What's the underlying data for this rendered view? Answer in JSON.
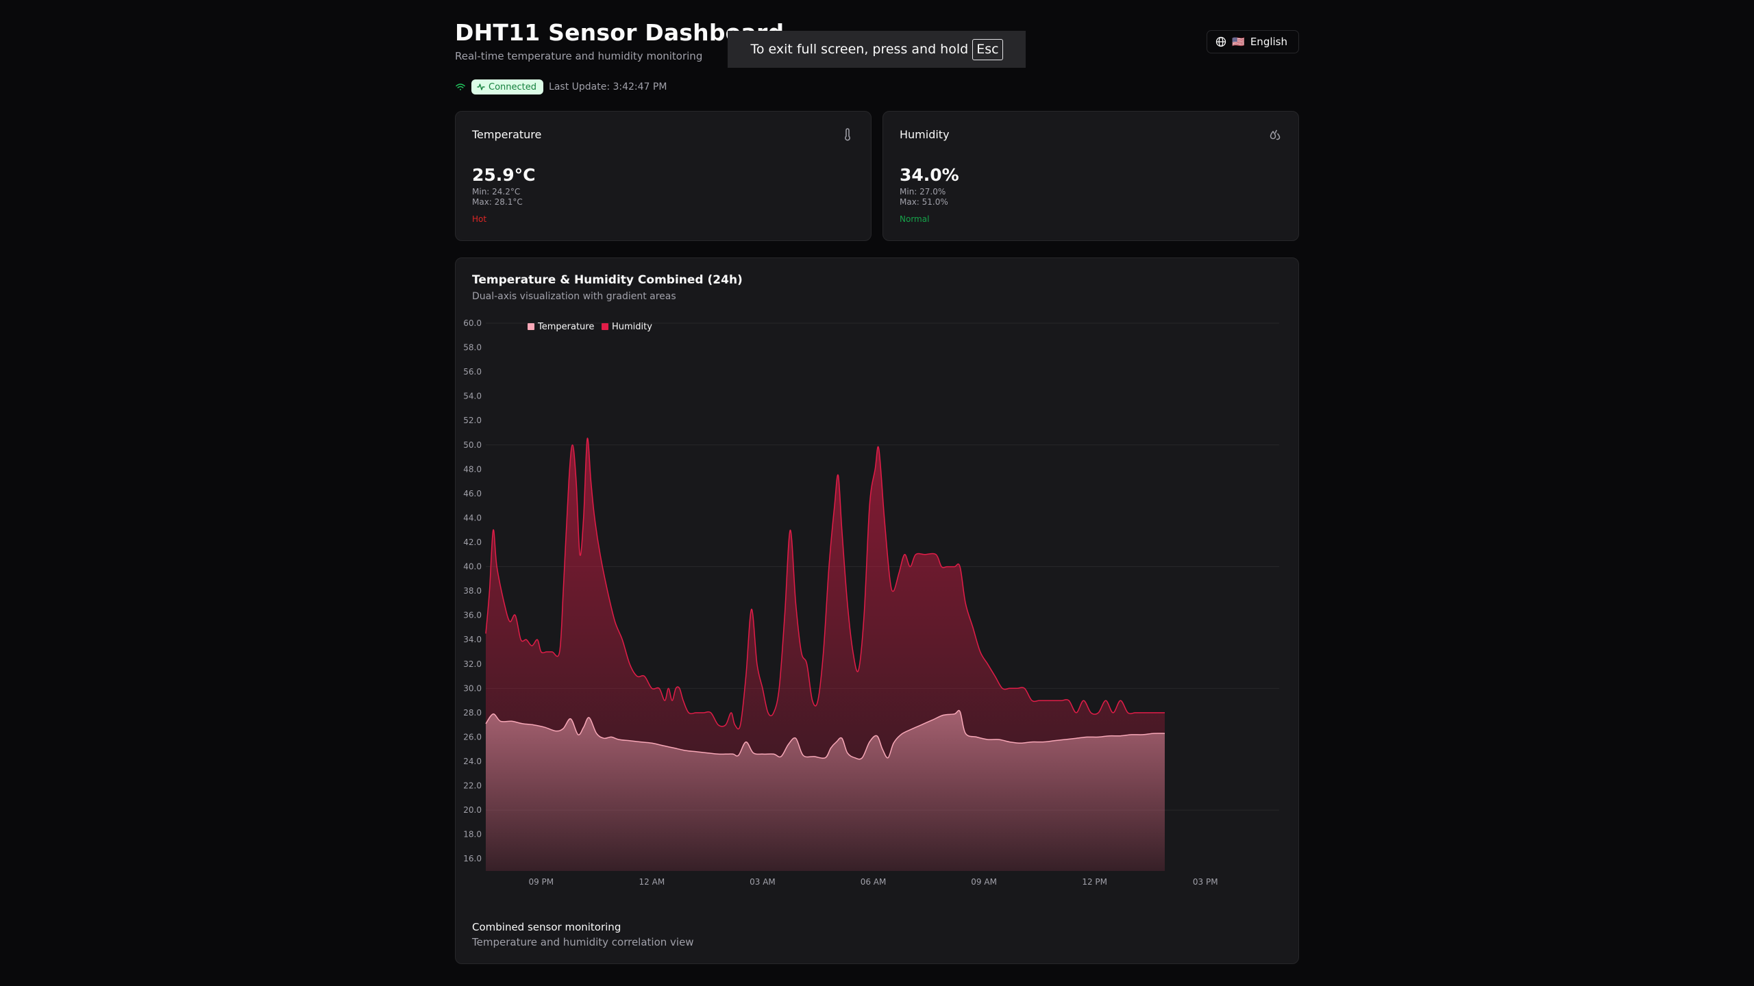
{
  "header": {
    "title": "DHT11 Sensor Dashboard",
    "subtitle": "Real-time temperature and humidity monitoring"
  },
  "language": {
    "flag": "🇺🇸",
    "label": "English"
  },
  "status": {
    "badge": "Connected",
    "last_update": "Last Update: 3:42:47 PM"
  },
  "cards": {
    "temperature": {
      "title": "Temperature",
      "value": "25.9°C",
      "min": "Min: 24.2°C",
      "max": "Max: 28.1°C",
      "status": "Hot",
      "status_color": "#dc2626"
    },
    "humidity": {
      "title": "Humidity",
      "value": "34.0%",
      "min": "Min: 27.0%",
      "max": "Max: 51.0%",
      "status": "Normal",
      "status_color": "#16a34a"
    }
  },
  "chart": {
    "title": "Temperature & Humidity Combined (24h)",
    "subtitle": "Dual-axis visualization with gradient areas",
    "footer_title": "Combined sensor monitoring",
    "footer_subtitle": "Temperature and humidity correlation view"
  },
  "fullscreen_toast": {
    "text": "To exit full screen, press and hold",
    "key": "Esc"
  },
  "colors": {
    "temperature": "#f9a8b8",
    "humidity": "#e11d48",
    "background": "#09090b",
    "card": "#18181b"
  },
  "chart_data": {
    "type": "area",
    "title": "Temperature & Humidity Combined (24h)",
    "legend": [
      "Temperature",
      "Humidity"
    ],
    "legend_position": "top-left",
    "grid": true,
    "x_ticks": [
      "09 PM",
      "12 AM",
      "03 AM",
      "06 AM",
      "09 AM",
      "12 PM",
      "03 PM"
    ],
    "y_ticks": [
      "60.0",
      "58.0",
      "56.0",
      "54.0",
      "52.0",
      "50.0",
      "48.0",
      "46.0",
      "44.0",
      "42.0",
      "40.0",
      "38.0",
      "36.0",
      "34.0",
      "32.0",
      "30.0",
      "28.0",
      "26.0",
      "24.0",
      "22.0",
      "20.0",
      "18.0",
      "16.0"
    ],
    "ylim": [
      15,
      60
    ],
    "x_range_hours": [
      -1.5,
      20
    ],
    "series": [
      {
        "name": "Humidity",
        "color": "#e11d48",
        "points": [
          [
            -1.5,
            34.5
          ],
          [
            -1.4,
            38
          ],
          [
            -1.3,
            43
          ],
          [
            -1.2,
            40
          ],
          [
            -1.0,
            37
          ],
          [
            -0.85,
            35.5
          ],
          [
            -0.7,
            36
          ],
          [
            -0.55,
            34
          ],
          [
            -0.4,
            34
          ],
          [
            -0.25,
            33.5
          ],
          [
            -0.1,
            34
          ],
          [
            0.0,
            33
          ],
          [
            0.15,
            33
          ],
          [
            0.3,
            33
          ],
          [
            0.5,
            33
          ],
          [
            0.6,
            38
          ],
          [
            0.75,
            47
          ],
          [
            0.85,
            50
          ],
          [
            0.95,
            47
          ],
          [
            1.05,
            41
          ],
          [
            1.15,
            44
          ],
          [
            1.25,
            50.5
          ],
          [
            1.35,
            47
          ],
          [
            1.45,
            44
          ],
          [
            1.6,
            41
          ],
          [
            1.8,
            38
          ],
          [
            2.0,
            35.5
          ],
          [
            2.2,
            34
          ],
          [
            2.4,
            32
          ],
          [
            2.6,
            31
          ],
          [
            2.8,
            31
          ],
          [
            3.0,
            30
          ],
          [
            3.2,
            30
          ],
          [
            3.35,
            29
          ],
          [
            3.45,
            30
          ],
          [
            3.55,
            29
          ],
          [
            3.65,
            30
          ],
          [
            3.75,
            30
          ],
          [
            3.85,
            29
          ],
          [
            4.0,
            28
          ],
          [
            4.2,
            28
          ],
          [
            4.4,
            28
          ],
          [
            4.6,
            28
          ],
          [
            4.8,
            27
          ],
          [
            5.0,
            27
          ],
          [
            5.15,
            28
          ],
          [
            5.25,
            27
          ],
          [
            5.4,
            27
          ],
          [
            5.55,
            31
          ],
          [
            5.7,
            36.5
          ],
          [
            5.85,
            32
          ],
          [
            6.0,
            30
          ],
          [
            6.15,
            28
          ],
          [
            6.3,
            28
          ],
          [
            6.45,
            30
          ],
          [
            6.6,
            36
          ],
          [
            6.75,
            43
          ],
          [
            6.9,
            37
          ],
          [
            7.05,
            33
          ],
          [
            7.2,
            32
          ],
          [
            7.35,
            29
          ],
          [
            7.5,
            29
          ],
          [
            7.65,
            33
          ],
          [
            7.8,
            40
          ],
          [
            7.95,
            45
          ],
          [
            8.05,
            47.5
          ],
          [
            8.15,
            43
          ],
          [
            8.3,
            37
          ],
          [
            8.45,
            33
          ],
          [
            8.6,
            31.5
          ],
          [
            8.75,
            36
          ],
          [
            8.9,
            45
          ],
          [
            9.05,
            48
          ],
          [
            9.15,
            49.7
          ],
          [
            9.3,
            44
          ],
          [
            9.45,
            39
          ],
          [
            9.55,
            38
          ],
          [
            9.7,
            39.5
          ],
          [
            9.85,
            41
          ],
          [
            10.0,
            40
          ],
          [
            10.15,
            41
          ],
          [
            10.4,
            41
          ],
          [
            10.7,
            41
          ],
          [
            10.85,
            40
          ],
          [
            11.0,
            40
          ],
          [
            11.2,
            40
          ],
          [
            11.35,
            40
          ],
          [
            11.5,
            37
          ],
          [
            11.7,
            35
          ],
          [
            11.9,
            33
          ],
          [
            12.1,
            32
          ],
          [
            12.3,
            31
          ],
          [
            12.5,
            30
          ],
          [
            12.7,
            30
          ],
          [
            12.9,
            30
          ],
          [
            13.1,
            30
          ],
          [
            13.3,
            29
          ],
          [
            13.5,
            29
          ],
          [
            13.7,
            29
          ],
          [
            13.9,
            29
          ],
          [
            14.1,
            29
          ],
          [
            14.3,
            29
          ],
          [
            14.5,
            28
          ],
          [
            14.7,
            29
          ],
          [
            14.9,
            28
          ],
          [
            15.1,
            28
          ],
          [
            15.3,
            29
          ],
          [
            15.5,
            28
          ],
          [
            15.7,
            29
          ],
          [
            15.9,
            28
          ],
          [
            16.1,
            28
          ],
          [
            16.3,
            28
          ],
          [
            16.5,
            28
          ],
          [
            16.7,
            28
          ],
          [
            16.9,
            28
          ]
        ]
      },
      {
        "name": "Temperature",
        "color": "#f9a8b8",
        "points": [
          [
            -1.5,
            27.1
          ],
          [
            -1.3,
            27.9
          ],
          [
            -1.1,
            27.3
          ],
          [
            -0.8,
            27.3
          ],
          [
            -0.5,
            27.1
          ],
          [
            -0.2,
            27
          ],
          [
            0.1,
            26.8
          ],
          [
            0.4,
            26.5
          ],
          [
            0.6,
            26.7
          ],
          [
            0.8,
            27.5
          ],
          [
            1.0,
            26.2
          ],
          [
            1.15,
            26.8
          ],
          [
            1.3,
            27.6
          ],
          [
            1.5,
            26.3
          ],
          [
            1.7,
            25.9
          ],
          [
            1.9,
            26
          ],
          [
            2.1,
            25.8
          ],
          [
            2.4,
            25.7
          ],
          [
            2.7,
            25.6
          ],
          [
            3.0,
            25.5
          ],
          [
            3.3,
            25.3
          ],
          [
            3.6,
            25.1
          ],
          [
            3.9,
            24.9
          ],
          [
            4.2,
            24.8
          ],
          [
            4.5,
            24.7
          ],
          [
            4.8,
            24.6
          ],
          [
            5.0,
            24.6
          ],
          [
            5.2,
            24.6
          ],
          [
            5.35,
            24.5
          ],
          [
            5.55,
            25.6
          ],
          [
            5.75,
            24.7
          ],
          [
            6.0,
            24.6
          ],
          [
            6.3,
            24.6
          ],
          [
            6.5,
            24.4
          ],
          [
            6.7,
            25.4
          ],
          [
            6.9,
            25.9
          ],
          [
            7.1,
            24.5
          ],
          [
            7.4,
            24.4
          ],
          [
            7.7,
            24.3
          ],
          [
            7.85,
            25.1
          ],
          [
            8.0,
            25.6
          ],
          [
            8.15,
            25.9
          ],
          [
            8.3,
            24.7
          ],
          [
            8.5,
            24.3
          ],
          [
            8.7,
            24.3
          ],
          [
            8.9,
            25.6
          ],
          [
            9.1,
            26.1
          ],
          [
            9.25,
            25
          ],
          [
            9.4,
            24.3
          ],
          [
            9.55,
            25.5
          ],
          [
            9.75,
            26.2
          ],
          [
            10.0,
            26.6
          ],
          [
            10.3,
            27
          ],
          [
            10.6,
            27.4
          ],
          [
            10.9,
            27.8
          ],
          [
            11.2,
            27.9
          ],
          [
            11.35,
            28.1
          ],
          [
            11.5,
            26.3
          ],
          [
            11.8,
            26
          ],
          [
            12.1,
            25.8
          ],
          [
            12.4,
            25.8
          ],
          [
            12.7,
            25.6
          ],
          [
            13.0,
            25.5
          ],
          [
            13.3,
            25.6
          ],
          [
            13.6,
            25.6
          ],
          [
            13.9,
            25.7
          ],
          [
            14.2,
            25.8
          ],
          [
            14.5,
            25.9
          ],
          [
            14.8,
            26
          ],
          [
            15.1,
            26
          ],
          [
            15.4,
            26.1
          ],
          [
            15.7,
            26.1
          ],
          [
            16.0,
            26.2
          ],
          [
            16.3,
            26.2
          ],
          [
            16.6,
            26.3
          ],
          [
            16.9,
            26.3
          ]
        ]
      }
    ]
  }
}
